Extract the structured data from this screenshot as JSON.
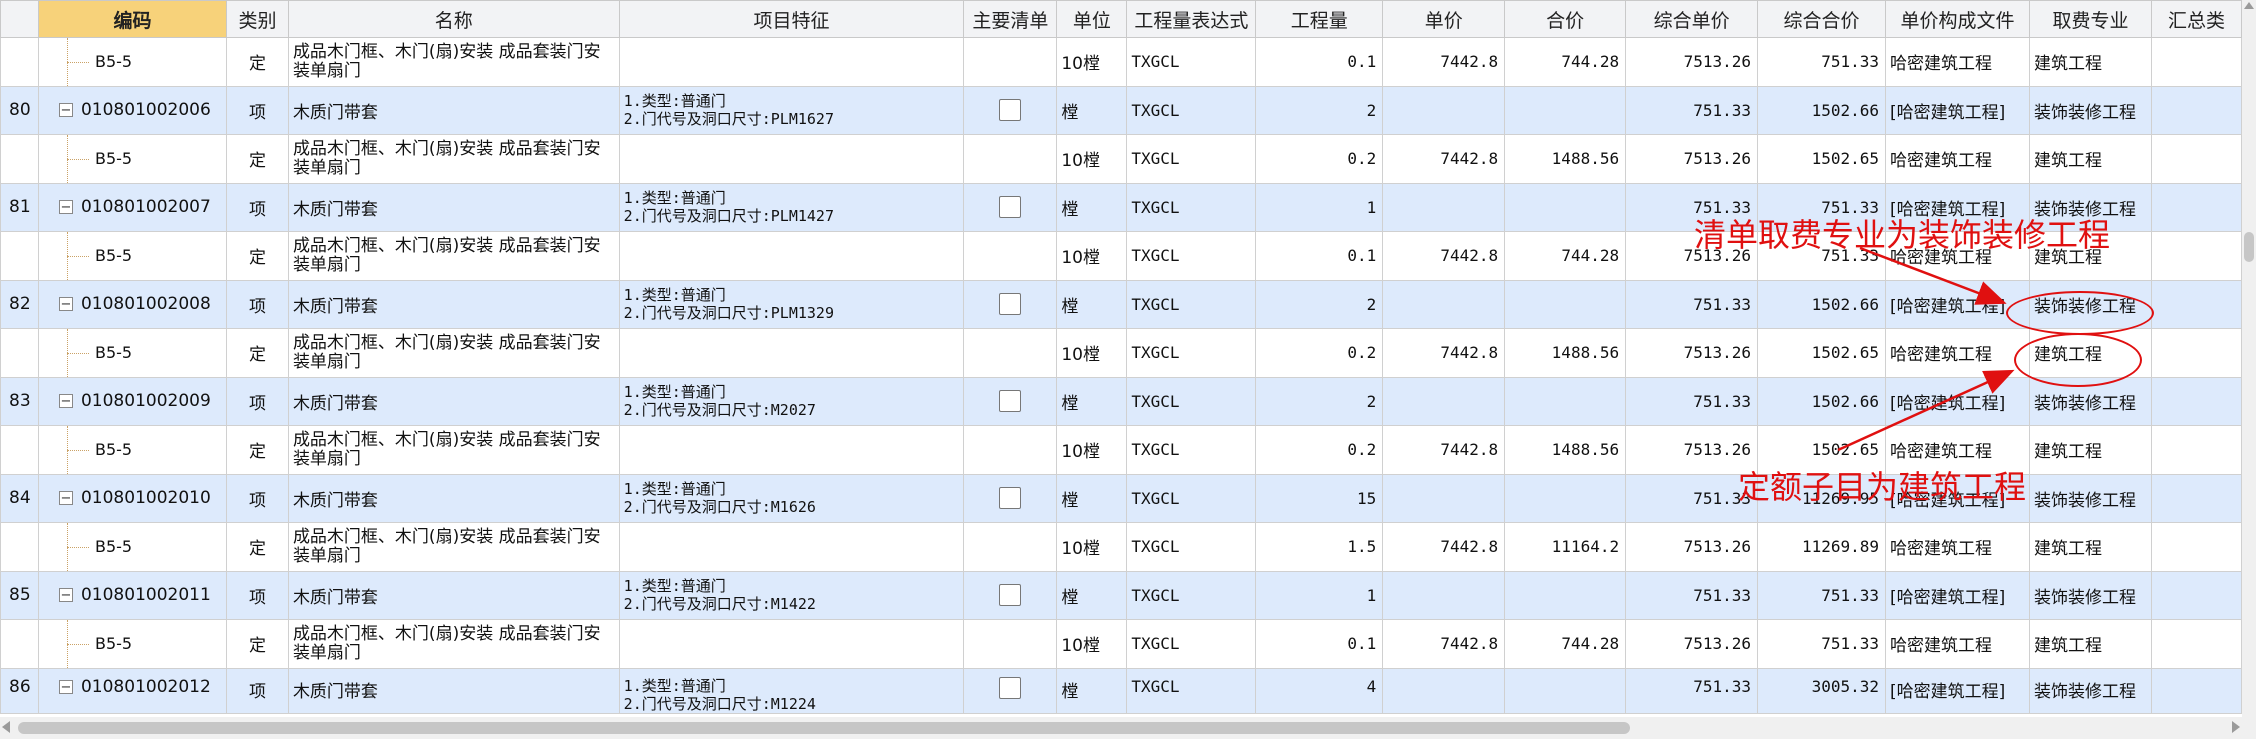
{
  "columns": [
    "编码",
    "类别",
    "名称",
    "项目特征",
    "主要清单",
    "单位",
    "工程量表达式",
    "工程量",
    "单价",
    "合价",
    "综合单价",
    "综合合价",
    "单价构成文件",
    "取费专业",
    "汇总类"
  ],
  "rows": [
    {
      "type": "quota",
      "num": "",
      "code": "B5-5",
      "cat": "定",
      "name": "成品木门框、木门(扇)安装 成品套装门安装单扇门",
      "feat1": "",
      "feat2": "",
      "check": false,
      "unit": "10樘",
      "expr": "TXGCL",
      "qty": "0.1",
      "price": "7442.8",
      "amount": "744.28",
      "uprice": "7513.26",
      "uamount": "751.33",
      "file": "哈密建筑工程",
      "fee": "建筑工程"
    },
    {
      "type": "item",
      "num": "80",
      "code": "010801002006",
      "cat": "项",
      "name": "木质门带套",
      "feat1": "1.类型:普通门",
      "feat2": "2.门代号及洞口尺寸:PLM1627",
      "check": true,
      "unit": "樘",
      "expr": "TXGCL",
      "qty": "2",
      "price": "",
      "amount": "",
      "uprice": "751.33",
      "uamount": "1502.66",
      "file": "[哈密建筑工程]",
      "fee": "装饰装修工程"
    },
    {
      "type": "quota",
      "num": "",
      "code": "B5-5",
      "cat": "定",
      "name": "成品木门框、木门(扇)安装 成品套装门安装单扇门",
      "feat1": "",
      "feat2": "",
      "check": false,
      "unit": "10樘",
      "expr": "TXGCL",
      "qty": "0.2",
      "price": "7442.8",
      "amount": "1488.56",
      "uprice": "7513.26",
      "uamount": "1502.65",
      "file": "哈密建筑工程",
      "fee": "建筑工程"
    },
    {
      "type": "item",
      "num": "81",
      "code": "010801002007",
      "cat": "项",
      "name": "木质门带套",
      "feat1": "1.类型:普通门",
      "feat2": "2.门代号及洞口尺寸:PLM1427",
      "check": true,
      "unit": "樘",
      "expr": "TXGCL",
      "qty": "1",
      "price": "",
      "amount": "",
      "uprice": "751.33",
      "uamount": "751.33",
      "file": "[哈密建筑工程]",
      "fee": "装饰装修工程"
    },
    {
      "type": "quota",
      "num": "",
      "code": "B5-5",
      "cat": "定",
      "name": "成品木门框、木门(扇)安装 成品套装门安装单扇门",
      "feat1": "",
      "feat2": "",
      "check": false,
      "unit": "10樘",
      "expr": "TXGCL",
      "qty": "0.1",
      "price": "7442.8",
      "amount": "744.28",
      "uprice": "7513.26",
      "uamount": "751.33",
      "file": "哈密建筑工程",
      "fee": "建筑工程"
    },
    {
      "type": "item",
      "num": "82",
      "code": "010801002008",
      "cat": "项",
      "name": "木质门带套",
      "feat1": "1.类型:普通门",
      "feat2": "2.门代号及洞口尺寸:PLM1329",
      "check": true,
      "unit": "樘",
      "expr": "TXGCL",
      "qty": "2",
      "price": "",
      "amount": "",
      "uprice": "751.33",
      "uamount": "1502.66",
      "file": "[哈密建筑工程]",
      "fee": "装饰装修工程"
    },
    {
      "type": "quota",
      "num": "",
      "code": "B5-5",
      "cat": "定",
      "name": "成品木门框、木门(扇)安装 成品套装门安装单扇门",
      "feat1": "",
      "feat2": "",
      "check": false,
      "unit": "10樘",
      "expr": "TXGCL",
      "qty": "0.2",
      "price": "7442.8",
      "amount": "1488.56",
      "uprice": "7513.26",
      "uamount": "1502.65",
      "file": "哈密建筑工程",
      "fee": "建筑工程"
    },
    {
      "type": "item",
      "num": "83",
      "code": "010801002009",
      "cat": "项",
      "name": "木质门带套",
      "feat1": "1.类型:普通门",
      "feat2": "2.门代号及洞口尺寸:M2027",
      "check": true,
      "unit": "樘",
      "expr": "TXGCL",
      "qty": "2",
      "price": "",
      "amount": "",
      "uprice": "751.33",
      "uamount": "1502.66",
      "file": "[哈密建筑工程]",
      "fee": "装饰装修工程"
    },
    {
      "type": "quota",
      "num": "",
      "code": "B5-5",
      "cat": "定",
      "name": "成品木门框、木门(扇)安装 成品套装门安装单扇门",
      "feat1": "",
      "feat2": "",
      "check": false,
      "unit": "10樘",
      "expr": "TXGCL",
      "qty": "0.2",
      "price": "7442.8",
      "amount": "1488.56",
      "uprice": "7513.26",
      "uamount": "1502.65",
      "file": "哈密建筑工程",
      "fee": "建筑工程"
    },
    {
      "type": "item",
      "num": "84",
      "code": "010801002010",
      "cat": "项",
      "name": "木质门带套",
      "feat1": "1.类型:普通门",
      "feat2": "2.门代号及洞口尺寸:M1626",
      "check": true,
      "unit": "樘",
      "expr": "TXGCL",
      "qty": "15",
      "price": "",
      "amount": "",
      "uprice": "751.33",
      "uamount": "11269.95",
      "file": "[哈密建筑工程]",
      "fee": "装饰装修工程"
    },
    {
      "type": "quota",
      "num": "",
      "code": "B5-5",
      "cat": "定",
      "name": "成品木门框、木门(扇)安装 成品套装门安装单扇门",
      "feat1": "",
      "feat2": "",
      "check": false,
      "unit": "10樘",
      "expr": "TXGCL",
      "qty": "1.5",
      "price": "7442.8",
      "amount": "11164.2",
      "uprice": "7513.26",
      "uamount": "11269.89",
      "file": "哈密建筑工程",
      "fee": "建筑工程"
    },
    {
      "type": "item",
      "num": "85",
      "code": "010801002011",
      "cat": "项",
      "name": "木质门带套",
      "feat1": "1.类型:普通门",
      "feat2": "2.门代号及洞口尺寸:M1422",
      "check": true,
      "unit": "樘",
      "expr": "TXGCL",
      "qty": "1",
      "price": "",
      "amount": "",
      "uprice": "751.33",
      "uamount": "751.33",
      "file": "[哈密建筑工程]",
      "fee": "装饰装修工程"
    },
    {
      "type": "quota",
      "num": "",
      "code": "B5-5",
      "cat": "定",
      "name": "成品木门框、木门(扇)安装 成品套装门安装单扇门",
      "feat1": "",
      "feat2": "",
      "check": false,
      "unit": "10樘",
      "expr": "TXGCL",
      "qty": "0.1",
      "price": "7442.8",
      "amount": "744.28",
      "uprice": "7513.26",
      "uamount": "751.33",
      "file": "哈密建筑工程",
      "fee": "建筑工程"
    },
    {
      "type": "item",
      "num": "86",
      "code": "010801002012",
      "cat": "项",
      "name": "木质门带套",
      "feat1": "1.类型:普通门",
      "feat2": "2.门代号及洞口尺寸:M1224",
      "check": true,
      "unit": "樘",
      "expr": "TXGCL",
      "qty": "4",
      "price": "",
      "amount": "",
      "uprice": "751.33",
      "uamount": "3005.32",
      "file": "[哈密建筑工程]",
      "fee": "装饰装修工程"
    }
  ],
  "annotations": {
    "top": "清单取费专业为装饰装修工程",
    "bottom": "定额子目为建筑工程",
    "color": "#e01010"
  },
  "icons": {
    "expander": "minus-box-icon",
    "checkbox": "checkbox-icon"
  }
}
